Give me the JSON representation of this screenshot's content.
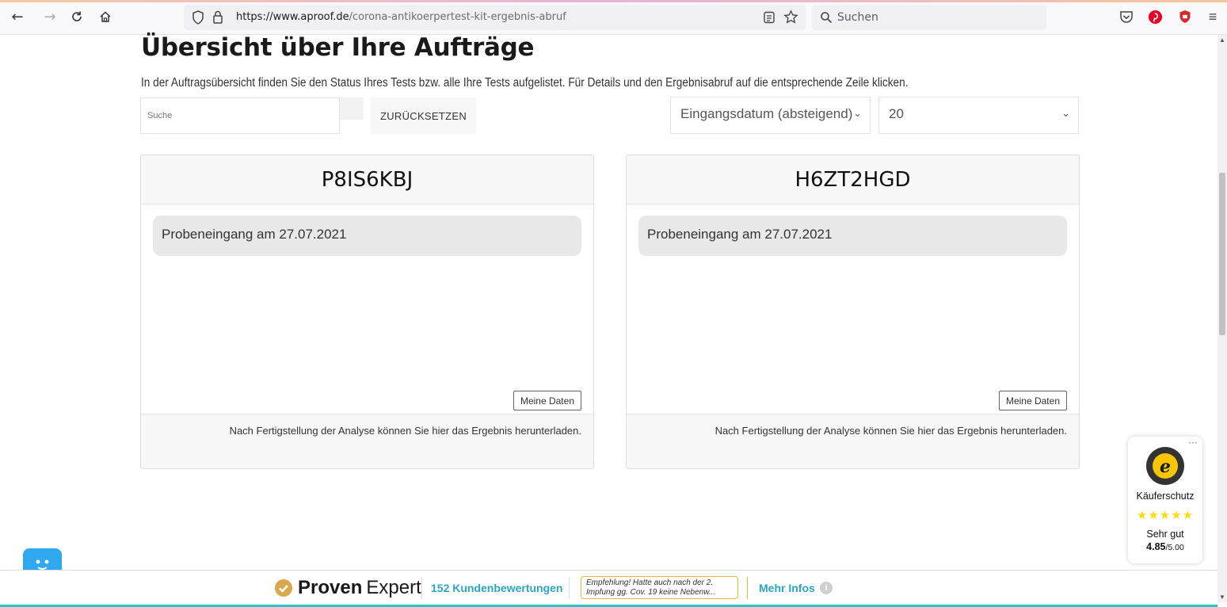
{
  "browser": {
    "url_domain": "https://www.aproof.de",
    "url_path": "/corona-antikoerpertest-kit-ergebnis-abruf",
    "search_placeholder": "Suchen"
  },
  "page": {
    "title": "Übersicht über Ihre Aufträge",
    "intro": "In der Auftragsübersicht finden Sie den Status Ihres Tests bzw. alle Ihre Tests aufgelistet. Für Details und den Ergebnisabruf auf die entsprechende Zeile klicken."
  },
  "filters": {
    "search_placeholder": "Suche",
    "reset_label": "ZURÜCKSETZEN",
    "sort_selected": "Eingangsdatum (absteigend)",
    "per_page_selected": "20"
  },
  "orders": [
    {
      "code": "P8IS6KBJ",
      "status": "Probeneingang am 27.07.2021",
      "my_data_label": "Meine Daten",
      "footer_note": "Nach Fertigstellung der Analyse können Sie hier das Ergebnis herunterladen."
    },
    {
      "code": "H6ZT2HGD",
      "status": "Probeneingang am 27.07.2021",
      "my_data_label": "Meine Daten",
      "footer_note": "Nach Fertigstellung der Analyse können Sie hier das Ergebnis herunterladen."
    }
  ],
  "trusted_shops": {
    "label": "Käuferschutz",
    "stars": "★★★★★",
    "rating_text": "Sehr gut",
    "score": "4.85",
    "score_max": "/5.00",
    "star_color": "#ffdc0f"
  },
  "proven_expert": {
    "brand_bold": "Proven",
    "brand_light": "Expert",
    "review_count": "152 Kundenbewertungen",
    "quote": "Empfehlung! Hatte auch nach der 2. Impfung gg. Cov. 19 keine Nebenw...",
    "more_label": "Mehr Infos",
    "accent_color": "#2aa6c4"
  }
}
